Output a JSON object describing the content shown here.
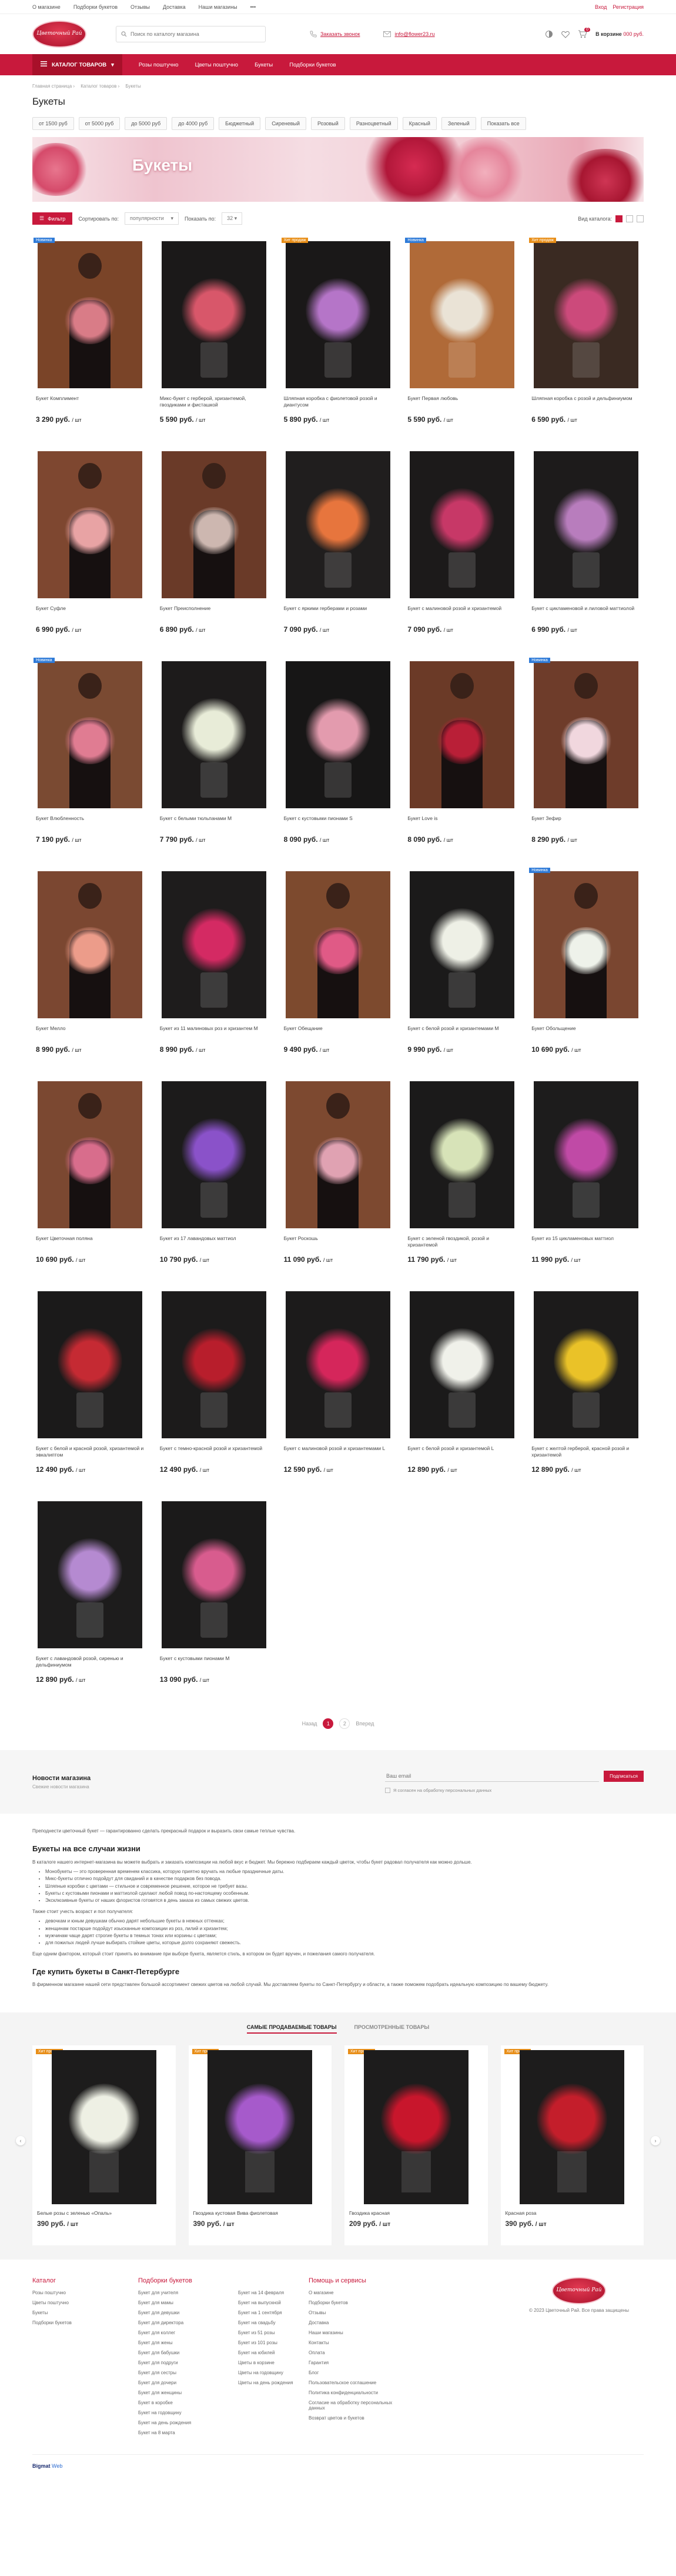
{
  "topbar": {
    "links": [
      "О магазине",
      "Подборки букетов",
      "Отзывы",
      "Доставка",
      "Наши магазины",
      "•••"
    ],
    "auth": [
      "Вход",
      "Регистрация"
    ]
  },
  "header": {
    "logo_text": "Цветочный Рай",
    "search_placeholder": "Поиск по каталогу магазина",
    "callback": "Заказать звонок",
    "email": "info@flower23.ru",
    "cart_title": "В корзине",
    "cart_total": "000 руб.",
    "cart_count": "0"
  },
  "nav": {
    "catalog": "КАТАЛОГ ТОВАРОВ",
    "items": [
      "Розы поштучно",
      "Цветы поштучно",
      "Букеты",
      "Подборки букетов"
    ]
  },
  "breadcrumbs": [
    "Главная страница",
    "Каталог товаров",
    "Букеты"
  ],
  "page_title": "Букеты",
  "price_chips": [
    "от 1500 руб",
    "от 5000 руб",
    "до 5000 руб",
    "до 4000 руб",
    "Бюджетный",
    "Сиреневый",
    "Розовый",
    "Разноцветный",
    "Красный",
    "Зеленый",
    "Показать все"
  ],
  "banner_title": "Букеты",
  "toolbar": {
    "filter": "Фильтр",
    "sort_label": "Сортировать по:",
    "sort_value": "популярности",
    "show_label": "Показать по:",
    "show_value": "32",
    "view_label": "Вид каталога:"
  },
  "tags_colors": {
    "Новинка": "#2f7bd8",
    "Хит продаж": "#e88e18"
  },
  "products": [
    {
      "tag": "Новинка",
      "name": "Букет Комплимент",
      "price": "3 290 руб.",
      "unit": "/ шт",
      "bg": "#7a4428",
      "fl": "#d97c87",
      "model": true
    },
    {
      "tag": "",
      "name": "Микс-букет с гербер­ой, хризантемой, гвоздиками и фисташкой",
      "price": "5 590 руб.",
      "unit": "/ шт",
      "bg": "#1b1919",
      "fl": "#d8576a",
      "model": false
    },
    {
      "tag": "Хит продаж",
      "name": "Шляпная коробка с фиолетовой розой и диантусом",
      "price": "5 890 руб.",
      "unit": "/ шт",
      "bg": "#1a1818",
      "fl": "#b575c8",
      "model": false
    },
    {
      "tag": "Новинка",
      "name": "Букет Первая любовь",
      "price": "5 590 руб.",
      "unit": "/ шт",
      "bg": "#b06a38",
      "fl": "#eae3d6",
      "model": false
    },
    {
      "tag": "Хит продаж",
      "name": "Шляпная коробка с розой и дельфиниумом",
      "price": "6 590 руб.",
      "unit": "/ шт",
      "bg": "#3a2a22",
      "fl": "#cc4a7b",
      "model": false
    },
    {
      "tag": "",
      "name": "Букет Суфле",
      "price": "6 990 руб.",
      "unit": "/ шт",
      "bg": "#7e4730",
      "fl": "#e8a3a4",
      "model": true
    },
    {
      "tag": "",
      "name": "Букет Преисполнение",
      "price": "6 890 руб.",
      "unit": "/ шт",
      "bg": "#6a3a28",
      "fl": "#cdb7b0",
      "model": true
    },
    {
      "tag": "",
      "name": "Букет с яркими гербера­ми и розами",
      "price": "7 090 руб.",
      "unit": "/ шт",
      "bg": "#201e1e",
      "fl": "#e7753d",
      "model": false
    },
    {
      "tag": "",
      "name": "Букет с малиновой розой и хризантемой",
      "price": "7 090 руб.",
      "unit": "/ шт",
      "bg": "#1c1a1a",
      "fl": "#c73867",
      "model": false
    },
    {
      "tag": "",
      "name": "Букет с цикламеновой и лиловой маттиолой",
      "price": "6 990 руб.",
      "unit": "/ шт",
      "bg": "#1d1b1b",
      "fl": "#b87dbd",
      "model": false
    },
    {
      "tag": "Новинка",
      "name": "Букет Влюбленность",
      "price": "7 190 руб.",
      "unit": "/ шт",
      "bg": "#7a4a32",
      "fl": "#e07c92",
      "model": true
    },
    {
      "tag": "",
      "name": "Букет с белыми тюльпанами M",
      "price": "7 790 руб.",
      "unit": "/ шт",
      "bg": "#1d1b1b",
      "fl": "#e8ecd8",
      "model": false
    },
    {
      "tag": "",
      "name": "Букет с кустовыми пионами S",
      "price": "8 090 руб.",
      "unit": "/ шт",
      "bg": "#171616",
      "fl": "#e39bae",
      "model": false
    },
    {
      "tag": "",
      "name": "Букет Love is",
      "price": "8 090 руб.",
      "unit": "/ шт",
      "bg": "#6b3a27",
      "fl": "#b91f37",
      "model": true
    },
    {
      "tag": "Новинка",
      "name": "Букет Зефир",
      "price": "8 290 руб.",
      "unit": "/ шт",
      "bg": "#6e3c2a",
      "fl": "#f1d7de",
      "model": true
    },
    {
      "tag": "",
      "name": "Букет Мелло",
      "price": "8 990 руб.",
      "unit": "/ шт",
      "bg": "#7b4731",
      "fl": "#ec9c8a",
      "model": true
    },
    {
      "tag": "",
      "name": "Букет из 11 малиновых роз и хризантем M",
      "price": "8 990 руб.",
      "unit": "/ шт",
      "bg": "#1e1c1c",
      "fl": "#d42a63",
      "model": false
    },
    {
      "tag": "",
      "name": "Букет Обещание",
      "price": "9 490 руб.",
      "unit": "/ шт",
      "bg": "#7d4a2e",
      "fl": "#e05a86",
      "model": true
    },
    {
      "tag": "",
      "name": "Букет с белой розой и хризантемами M",
      "price": "9 990 руб.",
      "unit": "/ шт",
      "bg": "#1b1a1a",
      "fl": "#eef0e6",
      "model": false
    },
    {
      "tag": "Новинка",
      "name": "Букет Обольщение",
      "price": "10 690 руб.",
      "unit": "/ шт",
      "bg": "#7a4630",
      "fl": "#eef2ea",
      "model": true
    },
    {
      "tag": "",
      "name": "Букет Цветочная поляна",
      "price": "10 690 руб.",
      "unit": "/ шт",
      "bg": "#7b4831",
      "fl": "#d86d8c",
      "model": true
    },
    {
      "tag": "",
      "name": "Букет из 17 лавандовых маттиол",
      "price": "10 790 руб.",
      "unit": "/ шт",
      "bg": "#1c1b1b",
      "fl": "#8a52c9",
      "model": false
    },
    {
      "tag": "",
      "name": "Букет Роскошь",
      "price": "11 090 руб.",
      "unit": "/ шт",
      "bg": "#7d4930",
      "fl": "#e0a2b2",
      "model": true
    },
    {
      "tag": "",
      "name": "Букет с зеленой гвоздикой, розой и хризантемой",
      "price": "11 790 руб.",
      "unit": "/ шт",
      "bg": "#1b1a1a",
      "fl": "#d7e3b8",
      "model": false
    },
    {
      "tag": "",
      "name": "Букет из 15 цикламеновых маттиол",
      "price": "11 990 руб.",
      "unit": "/ шт",
      "bg": "#1d1c1c",
      "fl": "#c04aa6",
      "model": false
    },
    {
      "tag": "",
      "name": "Букет с белой и красной розой, хризантемой и эвкалиптом",
      "price": "12 490 руб.",
      "unit": "/ шт",
      "bg": "#1b1a1a",
      "fl": "#c52a33",
      "model": false
    },
    {
      "tag": "",
      "name": "Букет с темно-красной розой и хризантемой",
      "price": "12 490 руб.",
      "unit": "/ шт",
      "bg": "#1c1b1b",
      "fl": "#b81e2c",
      "model": false
    },
    {
      "tag": "",
      "name": "Букет с малиновой розой и хризантемами L",
      "price": "12 590 руб.",
      "unit": "/ шт",
      "bg": "#1c1b1b",
      "fl": "#d5265b",
      "model": false
    },
    {
      "tag": "",
      "name": "Букет с белой розой и хризантемой L",
      "price": "12 890 руб.",
      "unit": "/ шт",
      "bg": "#1b1a1a",
      "fl": "#f0f1ea",
      "model": false
    },
    {
      "tag": "",
      "name": "Букет с желтой герберой, красной розой и хризантемой",
      "price": "12 890 руб.",
      "unit": "/ шт",
      "bg": "#1c1b1b",
      "fl": "#eac228",
      "model": false
    },
    {
      "tag": "",
      "name": "Букет с лавандовой розой, сиренью и дельфиниумом",
      "price": "12 890 руб.",
      "unit": "/ шт",
      "bg": "#1d1c1c",
      "fl": "#b58ad1",
      "model": false
    },
    {
      "tag": "",
      "name": "Букет с кустовыми пионами M",
      "price": "13 090 руб.",
      "unit": "/ шт",
      "bg": "#1b1a1a",
      "fl": "#d85c8e",
      "model": false
    }
  ],
  "pagination": {
    "prev": "Назад",
    "pages": [
      "1",
      "2"
    ],
    "current": "1",
    "next": "Вперед"
  },
  "subscribe": {
    "title": "Новости магазина",
    "subtitle": "Свежие новости магазина",
    "placeholder": "Ваш email",
    "button": "Подписаться",
    "consent": "Я согласен на обработку персональных данных"
  },
  "seo": {
    "intro": "Преподнести цветочный букет — гарантированно сделать прекрасный подарок и выразить свои самые теплые чувства.",
    "h1": "Букеты на все случаи жизни",
    "p1": "В каталоге нашего интернет-магазина вы можете выбрать и заказать композиции на любой вкус и бюджет. Мы бережно подбираем каждый цветок, чтобы букет радовал получателя как можно дольше.",
    "list1": [
      "Монобукеты — это проверенная временем классика, которую приятно вручать на любые праздничные даты.",
      "Микс-букеты отлично подойдут для свиданий и в качестве подарков без повода.",
      "Шляпные коробки с цветами — стильное и современное решение, которое не требует вазы.",
      "Букеты с кустовыми пионами и маттиолой сделают любой повод по-настоящему особенным.",
      "Эксклюзивные букеты от наших флористов готовятся в день заказа из самых свежих цветов."
    ],
    "p2": "Также стоит учесть возраст и пол получателя:",
    "list2": [
      "девочкам и юным девушкам обычно дарят небольшие букеты в нежных оттенках;",
      "женщинам постарше подойдут изысканные композиции из роз, лилий и хризантем;",
      "мужчинам чаще дарят строгие букеты в темных тонах или корзины с цветами;",
      "для пожилых людей лучше выбирать стойкие цветы, которые долго сохраняют свежесть."
    ],
    "p3": "Еще одним фактором, который стоит принять во внимание при выборе букета, является стиль, в котором он будет вручен, и пожелания самого получателя.",
    "h2": "Где купить букеты в Санкт-Петербурге",
    "p4": "В фирменном магазине нашей сети представлен большой ассортимент свежих цветов на любой случай. Мы доставляем букеты по Санкт-Петербургу и области, а также поможем подобрать идеальную композицию по вашему бюджету."
  },
  "best": {
    "tabs": [
      "САМЫЕ ПРОДАВАЕМЫЕ ТОВАРЫ",
      "ПРОСМОТРЕННЫЕ ТОВАРЫ"
    ],
    "items": [
      {
        "tag": "Хит продаж",
        "name": "Белые розы с зеленью «Опаль»",
        "price": "390 руб.",
        "unit": "/ шт",
        "fl": "#eef0e4"
      },
      {
        "tag": "Хит продаж",
        "name": "Гвоздика кустовая Вива фиолетовая",
        "price": "390 руб.",
        "unit": "/ шт",
        "fl": "#a65acb"
      },
      {
        "tag": "Хит продаж",
        "name": "Гвоздика красная",
        "price": "209 руб.",
        "unit": "/ шт",
        "fl": "#c8162c"
      },
      {
        "tag": "Хит продаж",
        "name": "Красная роза",
        "price": "390 руб.",
        "unit": "/ шт",
        "fl": "#c41e2b"
      }
    ]
  },
  "footer": {
    "col1_title": "Каталог",
    "col1": [
      "Розы поштучно",
      "Цветы поштучно",
      "Букеты",
      "Подборки букетов"
    ],
    "col2_title": "Подборки букетов",
    "col2": [
      "Букет для учителя",
      "Букет для мамы",
      "Букет для девушки",
      "Букет для директора",
      "Букет для коллег",
      "Букет для жены",
      "Букет для бабушки",
      "Букет для подруги",
      "Букет для сестры",
      "Букет для дочери",
      "Букет для женщины",
      "Букет в коробке",
      "Букет на годовщину",
      "Букет на день рождения",
      "Букет на 8 марта"
    ],
    "col3": [
      "Букет на 14 февраля",
      "Букет на выпускной",
      "Букет на 1 сентября",
      "Букет на свадьбу",
      "Букет из 51 розы",
      "Букет из 101 розы",
      "Букет на юбилей",
      "Цветы в корзине",
      "Цветы на годовщину",
      "Цветы на день рождения"
    ],
    "col4_title": "Помощь и сервисы",
    "col4": [
      "О магазине",
      "Подборки букетов",
      "Отзывы",
      "Доставка",
      "Наши магазины",
      "Контакты",
      "Оплата",
      "Гарантия",
      "Блог",
      "Пользовательское соглашение",
      "Политика конфиденциальности",
      "Согласие на обработку персональных данных",
      "Возврат цветов и букетов"
    ],
    "copyright": "© 2023 Цветочный Рай. Все права защищены",
    "dev_brand": "Bigmat",
    "dev_sub": "Web"
  }
}
